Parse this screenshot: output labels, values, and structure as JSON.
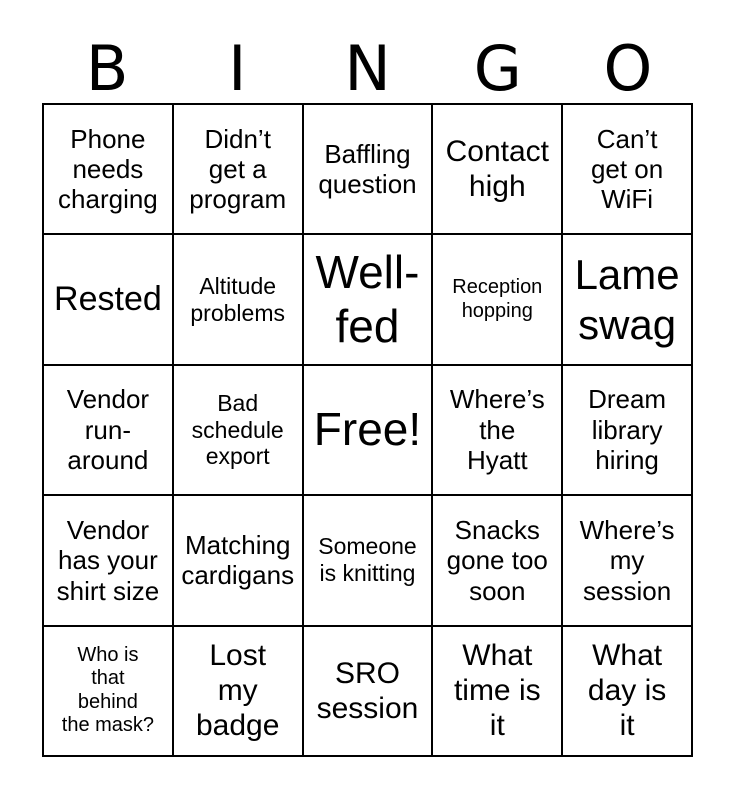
{
  "header": {
    "letters": [
      "B",
      "I",
      "N",
      "G",
      "O"
    ]
  },
  "style": {
    "border_color": "#000000",
    "background_color": "#ffffff",
    "text_color": "#000000"
  },
  "grid": {
    "columns": 5,
    "rows": 5,
    "cells": [
      {
        "text": "Phone\nneeds\ncharging",
        "size": "md",
        "free": false
      },
      {
        "text": "Didn’t\nget a\nprogram",
        "size": "md",
        "free": false
      },
      {
        "text": "Baffling\nquestion",
        "size": "md",
        "free": false
      },
      {
        "text": "Contact\nhigh",
        "size": "lg",
        "free": false
      },
      {
        "text": "Can’t\nget on\nWiFi",
        "size": "md",
        "free": false
      },
      {
        "text": "Rested",
        "size": "xl",
        "free": false
      },
      {
        "text": "Altitude\nproblems",
        "size": "sm",
        "free": false
      },
      {
        "text": "Well-\nfed",
        "size": "huge",
        "free": false
      },
      {
        "text": "Reception\nhopping",
        "size": "xs",
        "free": false
      },
      {
        "text": "Lame\nswag",
        "size": "xxl",
        "free": false
      },
      {
        "text": "Vendor\nrun-\naround",
        "size": "md",
        "free": false
      },
      {
        "text": "Bad\nschedule\nexport",
        "size": "sm",
        "free": false
      },
      {
        "text": "Free!",
        "size": "huge",
        "free": true
      },
      {
        "text": "Where’s\nthe\nHyatt",
        "size": "md",
        "free": false
      },
      {
        "text": "Dream\nlibrary\nhiring",
        "size": "md",
        "free": false
      },
      {
        "text": "Vendor\nhas your\nshirt size",
        "size": "md",
        "free": false
      },
      {
        "text": "Matching\ncardigans",
        "size": "md",
        "free": false
      },
      {
        "text": "Someone\nis knitting",
        "size": "sm",
        "free": false
      },
      {
        "text": "Snacks\ngone too\nsoon",
        "size": "md",
        "free": false
      },
      {
        "text": "Where’s\nmy\nsession",
        "size": "md",
        "free": false
      },
      {
        "text": "Who is\nthat\nbehind\nthe mask?",
        "size": "xs",
        "free": false
      },
      {
        "text": "Lost\nmy\nbadge",
        "size": "lg",
        "free": false
      },
      {
        "text": "SRO\nsession",
        "size": "lg",
        "free": false
      },
      {
        "text": "What\ntime is\nit",
        "size": "lg",
        "free": false
      },
      {
        "text": "What\nday is\nit",
        "size": "lg",
        "free": false
      }
    ]
  }
}
